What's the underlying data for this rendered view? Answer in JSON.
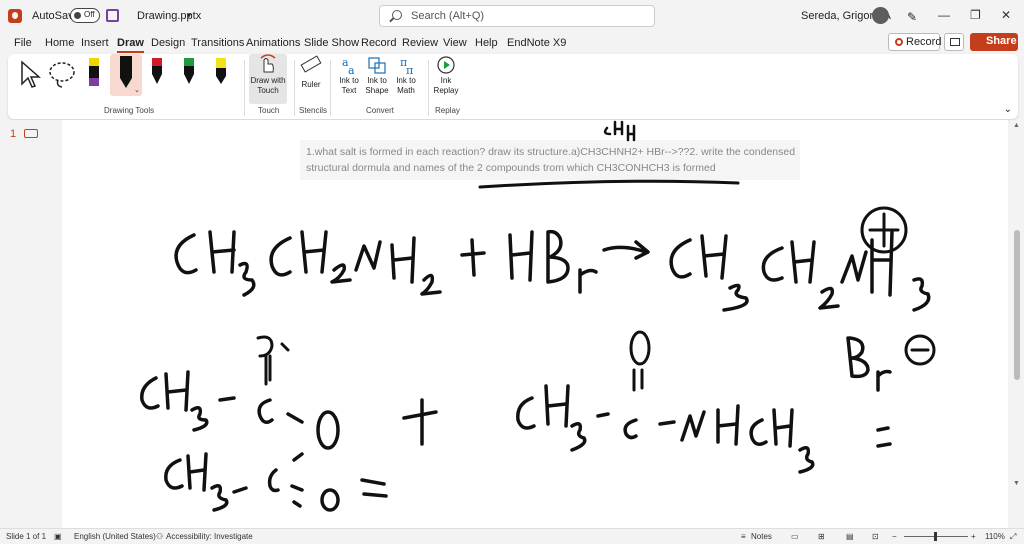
{
  "titlebar": {
    "autosave_label": "AutoSave",
    "autosave_state": "Off",
    "filename": "Drawing.pptx",
    "search_placeholder": "Search (Alt+Q)",
    "user_name": "Sereda, Grigoriy A"
  },
  "menu": {
    "tabs": [
      "File",
      "Home",
      "Insert",
      "Draw",
      "Design",
      "Transitions",
      "Animations",
      "Slide Show",
      "Record",
      "Review",
      "View",
      "Help",
      "EndNote X9"
    ],
    "active_tab": "Draw",
    "record_label": "Record",
    "share_label": "Share"
  },
  "ribbon": {
    "groups": {
      "drawing_tools": "Drawing Tools",
      "touch": "Touch",
      "stencils": "Stencils",
      "convert": "Convert",
      "replay": "Replay"
    },
    "buttons": {
      "draw_with_touch": "Draw with Touch",
      "ruler": "Ruler",
      "ink_to_text": "Ink to Text",
      "ink_to_shape": "Ink to Shape",
      "ink_to_math": "Ink to Math",
      "ink_replay": "Ink Replay"
    },
    "pen_colors": [
      "#7b3fa0",
      "#111111",
      "#d11a2a",
      "#1e9c3a",
      "#f2e21a"
    ]
  },
  "slide_pane": {
    "slide_number": "1"
  },
  "slide": {
    "prompt": "1.what salt is formed in each reaction? draw its structure.a)CH3CHNH2+ HBr-->??2. write the condensed structural dormula and names of the 2 compounds trom which CH3CONHCH3 is formed"
  },
  "statusbar": {
    "slide_info": "Slide 1 of 1",
    "language": "English (United States)",
    "accessibility": "Accessibility: Investigate",
    "notes": "Notes",
    "zoom": "110%"
  },
  "colors": {
    "accent": "#c43e1c",
    "ink": "#111111"
  }
}
